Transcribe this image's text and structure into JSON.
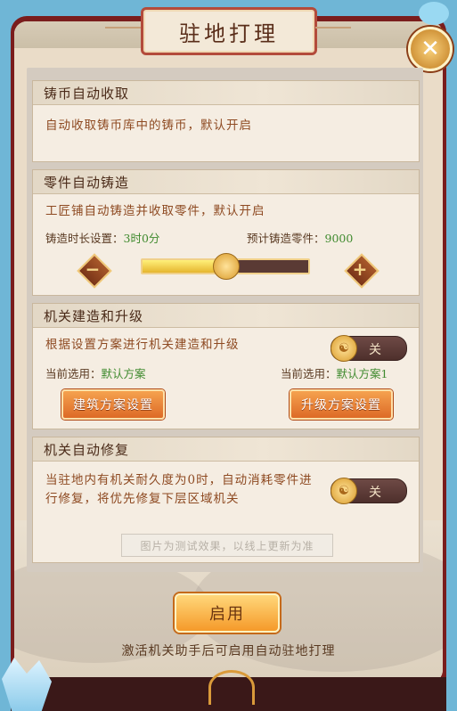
{
  "header": {
    "title": "驻地打理",
    "close_icon": "close-icon"
  },
  "sections": [
    {
      "title": "铸币自动收取",
      "desc": "自动收取铸币库中的铸币，默认开启"
    },
    {
      "title": "零件自动铸造",
      "desc": "工匠铺自动铸造并收取零件，默认开启",
      "duration_label": "铸造时长设置：",
      "duration_value": "3时0分",
      "expected_label": "预计铸造零件：",
      "expected_value": "9000",
      "minus_symbol": "−",
      "plus_symbol": "+",
      "slider_fraction": 0.5
    },
    {
      "title": "机关建造和升级",
      "desc": "根据设置方案进行机关建造和升级",
      "toggle_label": "关",
      "left_selected_label": "当前选用：",
      "left_selected_value": "默认方案",
      "right_selected_label": "当前选用：",
      "right_selected_value": "默认方案1",
      "build_button": "建筑方案设置",
      "upgrade_button": "升级方案设置"
    },
    {
      "title": "机关自动修复",
      "desc": "当驻地内有机关耐久度为0时，自动消耗零件进行修复，将优先修复下层区域机关",
      "toggle_label": "关"
    }
  ],
  "watermark": "图片为测试效果，以线上更新为准",
  "enable_button": "启用",
  "hint": "激活机关助手后可启用自动驻地打理",
  "colors": {
    "accent_orange": "#e57a30",
    "value_green": "#3f8a2e",
    "desc_brown": "#8e4a22",
    "frame_red": "#7a1d1d"
  }
}
